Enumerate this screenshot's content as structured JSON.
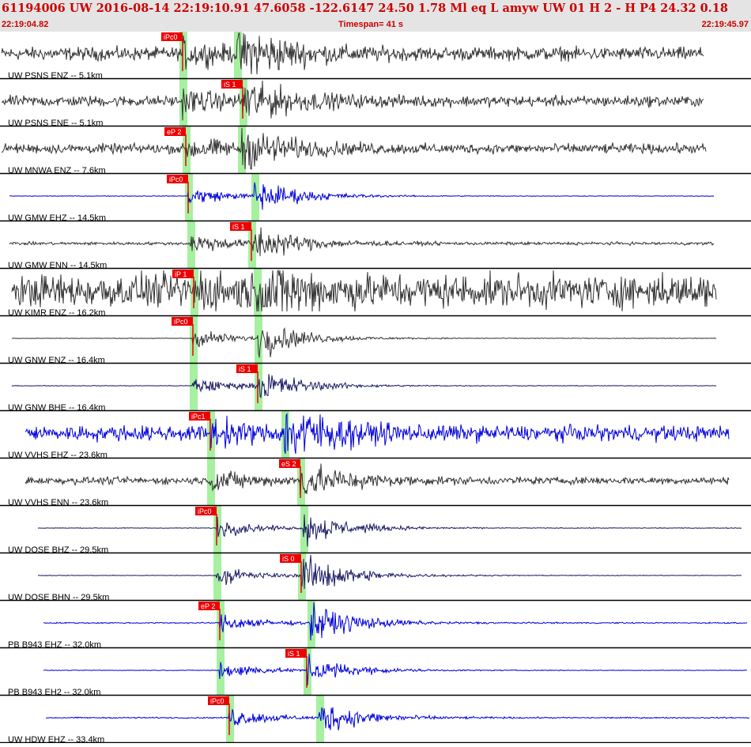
{
  "header": {
    "title": "61194006 UW 2016-08-14 22:19:10.91   47.6058 -122.6147  24.50  1.78 Ml  eq  L amyw     UW 01  H  2  -  H P4   24.32  0.18",
    "start_time": "22:19:04.82",
    "timespan_label": "Timespan=  41 s",
    "end_time": "22:19:45.97"
  },
  "colors": {
    "background": "#ffffff",
    "header_bg": "#e4e4e4",
    "header_text": "#cc0000",
    "trace_dark": "#333333",
    "trace_blue": "#0000dd",
    "trace_navy": "#1a1a66",
    "phase_band": "#a6f0a0",
    "pick_red": "#ee0000",
    "label_text": "#000000",
    "row_line": "#000000"
  },
  "traces": [
    {
      "label": "UW PSNS ENZ -- 5.1km",
      "color": "dark",
      "start": 2,
      "end": 890,
      "noise": 0.22,
      "p": {
        "label": "iPc0",
        "t": 231
      },
      "s": {
        "label": null,
        "t": 300
      },
      "amp": 0.95
    },
    {
      "label": "UW PSNS ENE -- 5.1km",
      "color": "dark",
      "start": 2,
      "end": 890,
      "noise": 0.18,
      "p": {
        "label": null,
        "t": 231
      },
      "s": {
        "label": "iS 1",
        "t": 307
      },
      "amp": 0.7
    },
    {
      "label": "UW MNWA ENZ -- 7.6km",
      "color": "dark",
      "start": 2,
      "end": 893,
      "noise": 0.16,
      "p": {
        "label": "eP 2",
        "t": 235
      },
      "s": {
        "label": null,
        "t": 305
      },
      "amp": 0.65
    },
    {
      "label": "UW GMW EHZ -- 14.5km",
      "color": "blue",
      "start": 12,
      "end": 903,
      "noise": 0.01,
      "p": {
        "label": "iPc0",
        "t": 238
      },
      "s": {
        "label": null,
        "t": 322
      },
      "amp": 0.55
    },
    {
      "label": "UW GMW ENN -- 14.5km",
      "color": "dark",
      "start": 12,
      "end": 903,
      "noise": 0.05,
      "p": {
        "label": null,
        "t": 241
      },
      "s": {
        "label": "iS 1",
        "t": 318
      },
      "amp": 0.6
    },
    {
      "label": "UW KIMR ENZ -- 16.2km",
      "color": "dark",
      "start": 15,
      "end": 906,
      "noise": 0.55,
      "p": {
        "label": "iP 1",
        "t": 245
      },
      "s": {
        "label": null,
        "t": 325
      },
      "amp": 0.8
    },
    {
      "label": "UW GNW ENZ -- 16.4km",
      "color": "dark",
      "start": 15,
      "end": 906,
      "noise": 0.01,
      "p": {
        "label": "iPc0",
        "t": 244
      },
      "s": {
        "label": null,
        "t": 326
      },
      "amp": 0.6
    },
    {
      "label": "UW GNW BHE -- 16.4km",
      "color": "navy",
      "start": 15,
      "end": 906,
      "noise": 0.01,
      "p": {
        "label": null,
        "t": 244
      },
      "s": {
        "label": "iS 1",
        "t": 326
      },
      "amp": 0.55
    },
    {
      "label": "UW VVHS EHZ -- 23.6km",
      "color": "blue",
      "start": 32,
      "end": 922,
      "noise": 0.25,
      "p": {
        "label": "iPc1",
        "t": 266
      },
      "s": {
        "label": null,
        "t": 360
      },
      "amp": 0.95
    },
    {
      "label": "UW VVHS ENN -- 23.6km",
      "color": "dark",
      "start": 32,
      "end": 922,
      "noise": 0.12,
      "p": {
        "label": null,
        "t": 266
      },
      "s": {
        "label": "eS 2",
        "t": 380
      },
      "amp": 0.6
    },
    {
      "label": "UW DOSE BHZ -- 29.5km",
      "color": "navy",
      "start": 48,
      "end": 938,
      "noise": 0.01,
      "p": {
        "label": "iPc0",
        "t": 274
      },
      "s": {
        "label": null,
        "t": 384
      },
      "amp": 0.55
    },
    {
      "label": "UW DOSE BHN -- 29.5km",
      "color": "navy",
      "start": 48,
      "end": 938,
      "noise": 0.01,
      "p": {
        "label": null,
        "t": 274
      },
      "s": {
        "label": "iS 0",
        "t": 381
      },
      "amp": 0.75
    },
    {
      "label": "PB B943 EHZ -- 32.0km",
      "color": "blue",
      "start": 55,
      "end": 945,
      "noise": 0.02,
      "p": {
        "label": "eP 2",
        "t": 278
      },
      "s": {
        "label": null,
        "t": 393
      },
      "amp": 0.65
    },
    {
      "label": "PB B943 EH2 -- 32.0km",
      "color": "blue",
      "start": 55,
      "end": 945,
      "noise": 0.01,
      "p": {
        "label": null,
        "t": 278
      },
      "s": {
        "label": "iS 1",
        "t": 388
      },
      "amp": 0.45
    },
    {
      "label": "UW HDW EHZ -- 33.4km",
      "color": "blue",
      "start": 58,
      "end": 948,
      "noise": 0.02,
      "p": {
        "label": "iPc0",
        "t": 290
      },
      "s": {
        "label": null,
        "t": 404
      },
      "amp": 0.55
    }
  ]
}
